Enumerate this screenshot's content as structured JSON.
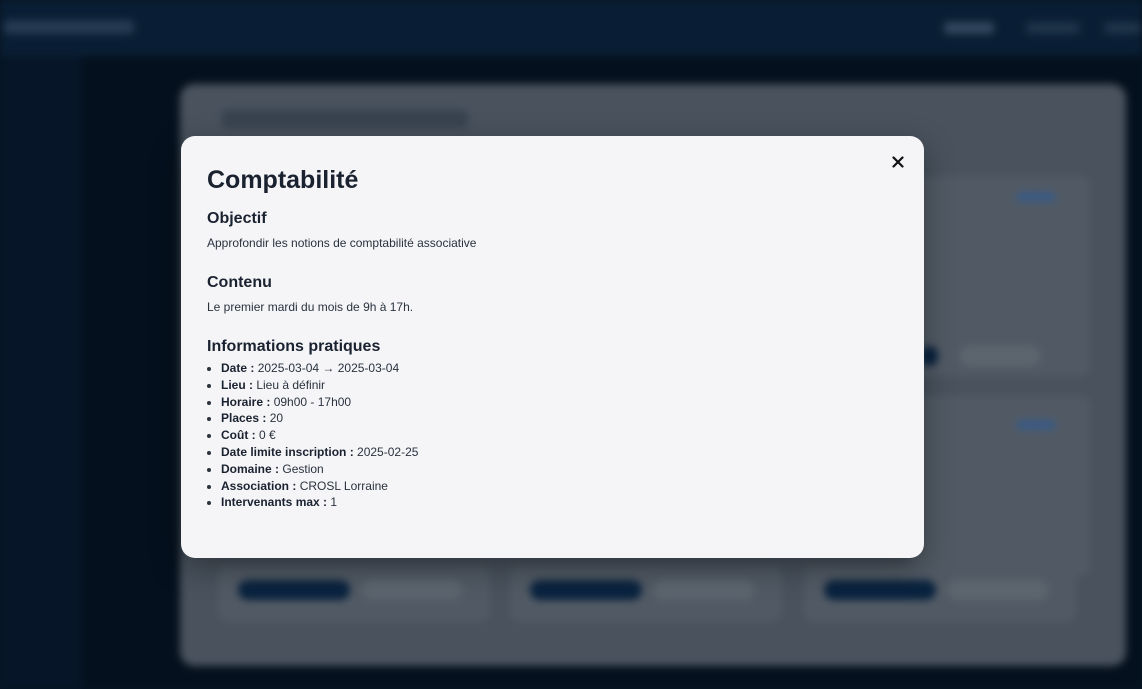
{
  "modal": {
    "title": "Comptabilité",
    "close_icon": "close-icon",
    "objective": {
      "heading": "Objectif",
      "text": "Approfondir les notions de comptabilité associative"
    },
    "content": {
      "heading": "Contenu",
      "text": "Le premier mardi du mois de 9h à 17h."
    },
    "practical": {
      "heading": "Informations pratiques",
      "items": [
        {
          "label": "Date :",
          "value": "2025-03-04 → 2025-03-04"
        },
        {
          "label": "Lieu :",
          "value": "Lieu à définir"
        },
        {
          "label": "Horaire :",
          "value": "09h00 - 17h00"
        },
        {
          "label": "Places :",
          "value": "20"
        },
        {
          "label": "Coût :",
          "value": "0 €"
        },
        {
          "label": "Date limite inscription :",
          "value": "2025-02-25"
        },
        {
          "label": "Domaine :",
          "value": "Gestion"
        },
        {
          "label": "Association :",
          "value": "CROSL Lorraine"
        },
        {
          "label": "Intervenants max :",
          "value": "1"
        }
      ]
    }
  },
  "colors": {
    "modal_bg": "#f5f5f8",
    "backdrop": "#0b1a2b",
    "text": "#1a2230",
    "accent_dark": "#0f3156"
  }
}
